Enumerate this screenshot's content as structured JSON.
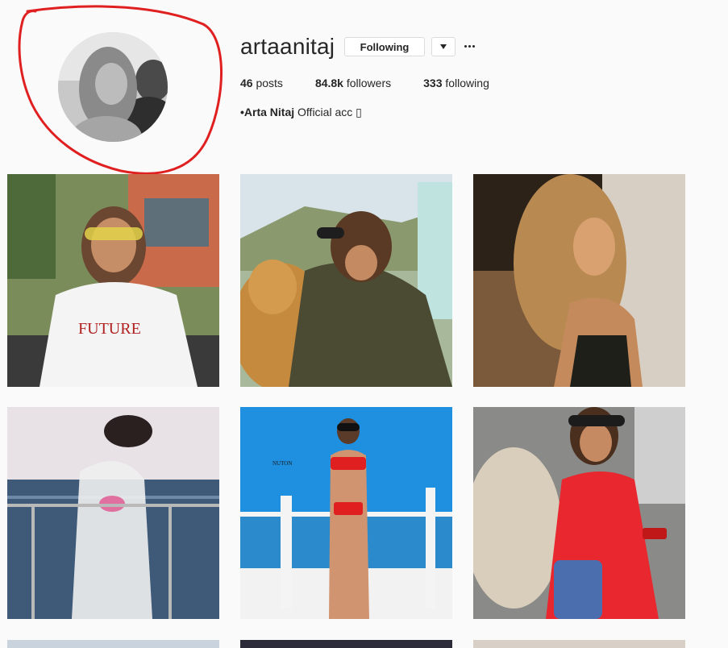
{
  "profile": {
    "username": "artaanitaj",
    "follow_label": "Following",
    "posts_count": "46",
    "posts_label": "posts",
    "followers_count": "84.8k",
    "followers_label": "followers",
    "following_count": "333",
    "following_label": "following",
    "bio_name": "•Arta Nitaj",
    "bio_text": " Official acc ▯",
    "icons": [
      "chevron-down-icon",
      "more-options-icon"
    ]
  },
  "annotation": {
    "color": "#e02020"
  },
  "posts": [
    {
      "label": "post-1",
      "theme": "warm-street"
    },
    {
      "label": "post-2",
      "theme": "dog-outdoor"
    },
    {
      "label": "post-3",
      "theme": "sunset"
    },
    {
      "label": "post-4",
      "theme": "sea-lace"
    },
    {
      "label": "post-5",
      "theme": "beach-red-bikini"
    },
    {
      "label": "post-6",
      "theme": "red-dress"
    },
    {
      "label": "post-7",
      "theme": "partial"
    },
    {
      "label": "post-8",
      "theme": "partial-dark"
    },
    {
      "label": "post-9",
      "theme": "partial"
    }
  ]
}
